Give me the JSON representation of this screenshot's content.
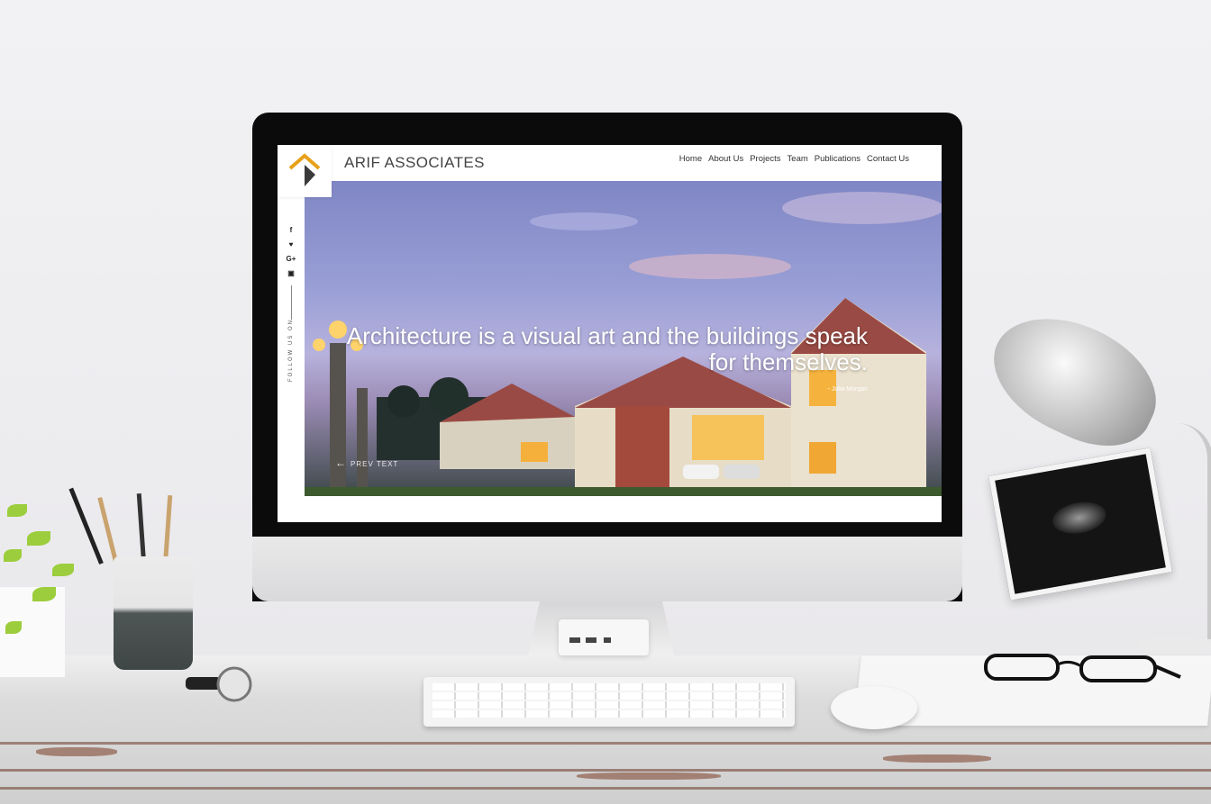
{
  "site": {
    "brand": "ARIF ASSOCIATES",
    "nav": [
      "Home",
      "About Us",
      "Projects",
      "Team",
      "Publications",
      "Contact Us"
    ],
    "social": [
      {
        "icon": "facebook-icon",
        "glyph": "f"
      },
      {
        "icon": "twitter-icon",
        "glyph": "♥"
      },
      {
        "icon": "google-plus-icon",
        "glyph": "G+"
      },
      {
        "icon": "instagram-icon",
        "glyph": "▣"
      }
    ],
    "follow_label": "FOLLOW US ON",
    "hero": {
      "quote": "Architecture is a visual art and the buildings speak for themselves.",
      "author": "- Julia Morgan",
      "prev_label": "PREV TEXT"
    }
  },
  "colors": {
    "logo_orange": "#e8a01a",
    "logo_dark": "#3a3a3a",
    "sky_top": "#7f86c4",
    "sky_bottom": "#b7b2dd"
  }
}
